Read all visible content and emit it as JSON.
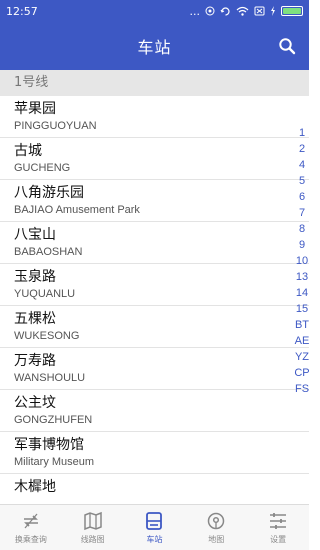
{
  "status": {
    "time": "12:57",
    "dots": "..."
  },
  "appbar": {
    "title": "车站"
  },
  "section": {
    "label": "1号线"
  },
  "stations": [
    {
      "cn": "苹果园",
      "en": "PINGGUOYUAN"
    },
    {
      "cn": "古城",
      "en": "GUCHENG"
    },
    {
      "cn": "八角游乐园",
      "en": "BAJIAO Amusement Park"
    },
    {
      "cn": "八宝山",
      "en": "BABAOSHAN"
    },
    {
      "cn": "玉泉路",
      "en": "YUQUANLU"
    },
    {
      "cn": "五棵松",
      "en": "WUKESONG"
    },
    {
      "cn": "万寿路",
      "en": "WANSHOULU"
    },
    {
      "cn": "公主坟",
      "en": "GONGZHUFEN"
    },
    {
      "cn": "军事博物馆",
      "en": "Military Museum"
    },
    {
      "cn": "木樨地",
      "en": ""
    }
  ],
  "index": [
    "1",
    "2",
    "4",
    "5",
    "6",
    "7",
    "8",
    "9",
    "10",
    "13",
    "14",
    "15",
    "BT",
    "AE",
    "YZ",
    "CP",
    "FS"
  ],
  "tabs": [
    {
      "label": "换乘查询",
      "icon": "transfer-icon",
      "active": false
    },
    {
      "label": "线路图",
      "icon": "map-book-icon",
      "active": false
    },
    {
      "label": "车站",
      "icon": "train-icon",
      "active": true
    },
    {
      "label": "地图",
      "icon": "location-pin-icon",
      "active": false
    },
    {
      "label": "设置",
      "icon": "sliders-icon",
      "active": false
    }
  ],
  "colors": {
    "primary": "#3d58c4",
    "section_bg": "#e6e6e6"
  }
}
